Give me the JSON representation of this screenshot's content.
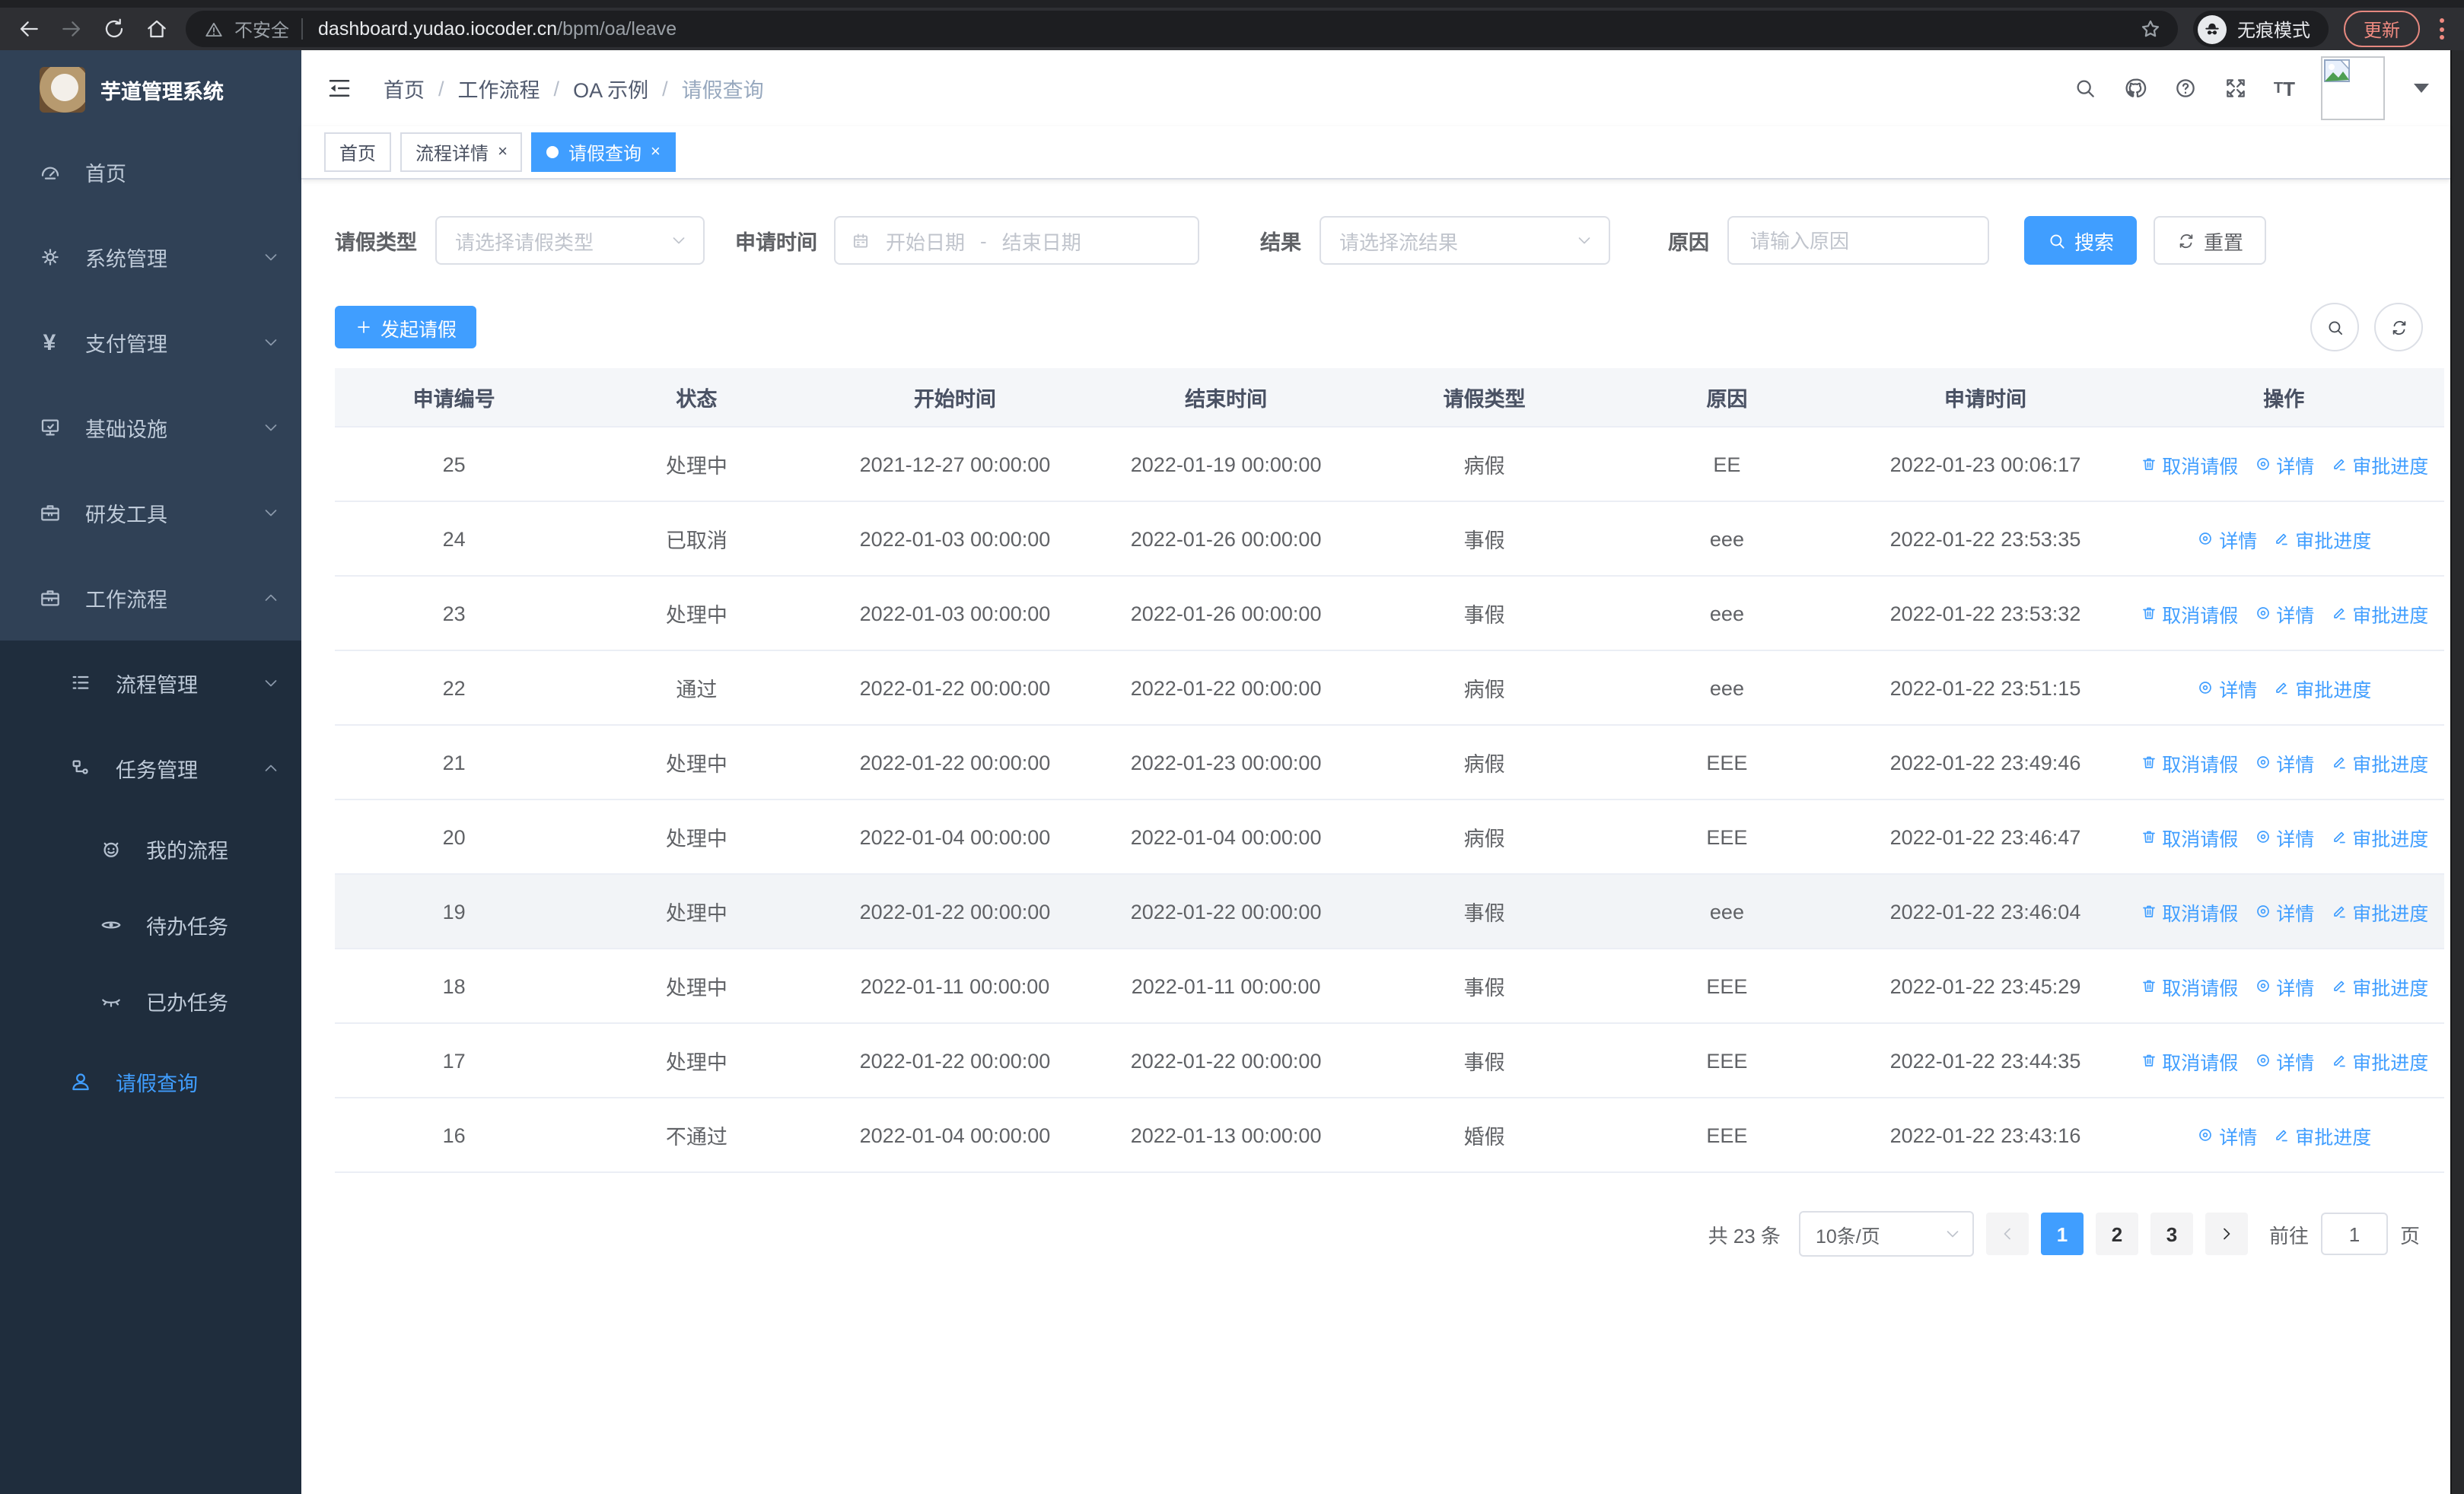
{
  "browser": {
    "security_label": "不安全",
    "url_host": "dashboard.yudao.iocoder.cn",
    "url_path": "/bpm/oa/leave",
    "incognito_label": "无痕模式",
    "update_label": "更新"
  },
  "colors": {
    "accent": "#409eff",
    "sidebar_bg": "#304156",
    "sidebar_submenu_bg": "#1f2d3d",
    "sidebar_text": "#bfcbd9",
    "link_blue": "#409eff",
    "update_red": "#ef8a80"
  },
  "sidebar": {
    "title": "芋道管理系统",
    "items": [
      {
        "label": "首页",
        "icon": "dashboard-icon",
        "level": 1
      },
      {
        "label": "系统管理",
        "icon": "gear-icon",
        "level": 1,
        "expandable": true
      },
      {
        "label": "支付管理",
        "icon": "yen-icon",
        "level": 1,
        "expandable": true
      },
      {
        "label": "基础设施",
        "icon": "monitor-icon",
        "level": 1,
        "expandable": true
      },
      {
        "label": "研发工具",
        "icon": "toolbox-icon",
        "level": 1,
        "expandable": true
      },
      {
        "label": "工作流程",
        "icon": "briefcase-icon",
        "level": 1,
        "expandable": true,
        "expanded": true
      },
      {
        "label": "流程管理",
        "icon": "flow-list-icon",
        "level": 2,
        "expandable": true
      },
      {
        "label": "任务管理",
        "icon": "task-branch-icon",
        "level": 2,
        "expandable": true,
        "expanded": true
      },
      {
        "label": "我的流程",
        "icon": "robot-icon",
        "level": 3
      },
      {
        "label": "待办任务",
        "icon": "eye-icon",
        "level": 3
      },
      {
        "label": "已办任务",
        "icon": "eye-closed-icon",
        "level": 3
      },
      {
        "label": "请假查询",
        "icon": "user-icon",
        "level": 2,
        "active": true
      }
    ]
  },
  "header": {
    "breadcrumb": [
      "首页",
      "工作流程",
      "OA 示例",
      "请假查询"
    ],
    "separator": "/",
    "tabs": [
      {
        "label": "首页",
        "closable": false,
        "active": false
      },
      {
        "label": "流程详情",
        "closable": true,
        "active": false
      },
      {
        "label": "请假查询",
        "closable": true,
        "active": true
      }
    ],
    "close_glyph": "×"
  },
  "filters": {
    "leave_type_label": "请假类型",
    "leave_type_placeholder": "请选择请假类型",
    "apply_time_label": "申请时间",
    "date_start_placeholder": "开始日期",
    "date_separator": "-",
    "date_end_placeholder": "结束日期",
    "result_label": "结果",
    "result_placeholder": "请选择流结果",
    "reason_label": "原因",
    "reason_placeholder": "请输入原因",
    "search_label": "搜索",
    "reset_label": "重置"
  },
  "toolbar": {
    "create_label": "发起请假"
  },
  "table": {
    "columns": [
      "申请编号",
      "状态",
      "开始时间",
      "结束时间",
      "请假类型",
      "原因",
      "申请时间",
      "操作"
    ],
    "action_labels": {
      "cancel": "取消请假",
      "detail": "详情",
      "progress": "审批进度"
    },
    "rows": [
      {
        "id": "25",
        "status": "处理中",
        "start": "2021-12-27 00:00:00",
        "end": "2022-01-19 00:00:00",
        "type": "病假",
        "reason": "EE",
        "applied": "2022-01-23 00:06:17"
      },
      {
        "id": "24",
        "status": "已取消",
        "start": "2022-01-03 00:00:00",
        "end": "2022-01-26 00:00:00",
        "type": "事假",
        "reason": "eee",
        "applied": "2022-01-22 23:53:35"
      },
      {
        "id": "23",
        "status": "处理中",
        "start": "2022-01-03 00:00:00",
        "end": "2022-01-26 00:00:00",
        "type": "事假",
        "reason": "eee",
        "applied": "2022-01-22 23:53:32"
      },
      {
        "id": "22",
        "status": "通过",
        "start": "2022-01-22 00:00:00",
        "end": "2022-01-22 00:00:00",
        "type": "病假",
        "reason": "eee",
        "applied": "2022-01-22 23:51:15"
      },
      {
        "id": "21",
        "status": "处理中",
        "start": "2022-01-22 00:00:00",
        "end": "2022-01-23 00:00:00",
        "type": "病假",
        "reason": "EEE",
        "applied": "2022-01-22 23:49:46"
      },
      {
        "id": "20",
        "status": "处理中",
        "start": "2022-01-04 00:00:00",
        "end": "2022-01-04 00:00:00",
        "type": "病假",
        "reason": "EEE",
        "applied": "2022-01-22 23:46:47"
      },
      {
        "id": "19",
        "status": "处理中",
        "start": "2022-01-22 00:00:00",
        "end": "2022-01-22 00:00:00",
        "type": "事假",
        "reason": "eee",
        "applied": "2022-01-22 23:46:04"
      },
      {
        "id": "18",
        "status": "处理中",
        "start": "2022-01-11 00:00:00",
        "end": "2022-01-11 00:00:00",
        "type": "事假",
        "reason": "EEE",
        "applied": "2022-01-22 23:45:29"
      },
      {
        "id": "17",
        "status": "处理中",
        "start": "2022-01-22 00:00:00",
        "end": "2022-01-22 00:00:00",
        "type": "事假",
        "reason": "EEE",
        "applied": "2022-01-22 23:44:35"
      },
      {
        "id": "16",
        "status": "不通过",
        "start": "2022-01-04 00:00:00",
        "end": "2022-01-13 00:00:00",
        "type": "婚假",
        "reason": "EEE",
        "applied": "2022-01-22 23:43:16"
      }
    ]
  },
  "pagination": {
    "total_label": "共 23 条",
    "page_size_label": "10条/页",
    "pages": [
      "1",
      "2",
      "3"
    ],
    "active_page": "1",
    "goto_label": "前往",
    "goto_value": "1",
    "page_unit": "页"
  }
}
